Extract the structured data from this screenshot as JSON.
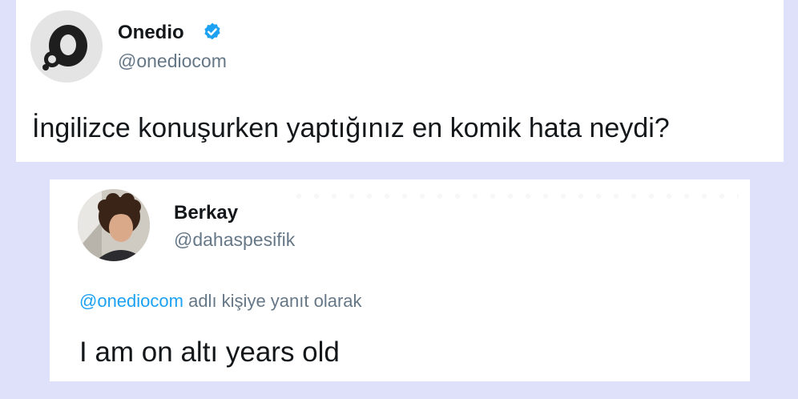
{
  "original_tweet": {
    "display_name": "Onedio",
    "handle": "@onediocom",
    "verified": true,
    "text": "İngilizce konuşurken yaptığınız en komik hata neydi?"
  },
  "reply_tweet": {
    "display_name": "Berkay",
    "handle": "@dahaspesifik",
    "reply_to_mention": "@onediocom",
    "reply_to_suffix": " adlı kişiye yanıt olarak",
    "text": "I am on altı years old"
  },
  "colors": {
    "background": "#dfe1fa",
    "card": "#ffffff",
    "text_primary": "#14171a",
    "text_secondary": "#657786",
    "link": "#1da1f2",
    "verified_badge": "#1da1f2"
  },
  "icons": {
    "verified": "verified-badge-icon",
    "onedio_avatar": "onedio-logo-avatar",
    "berkay_avatar": "user-photo-avatar"
  }
}
